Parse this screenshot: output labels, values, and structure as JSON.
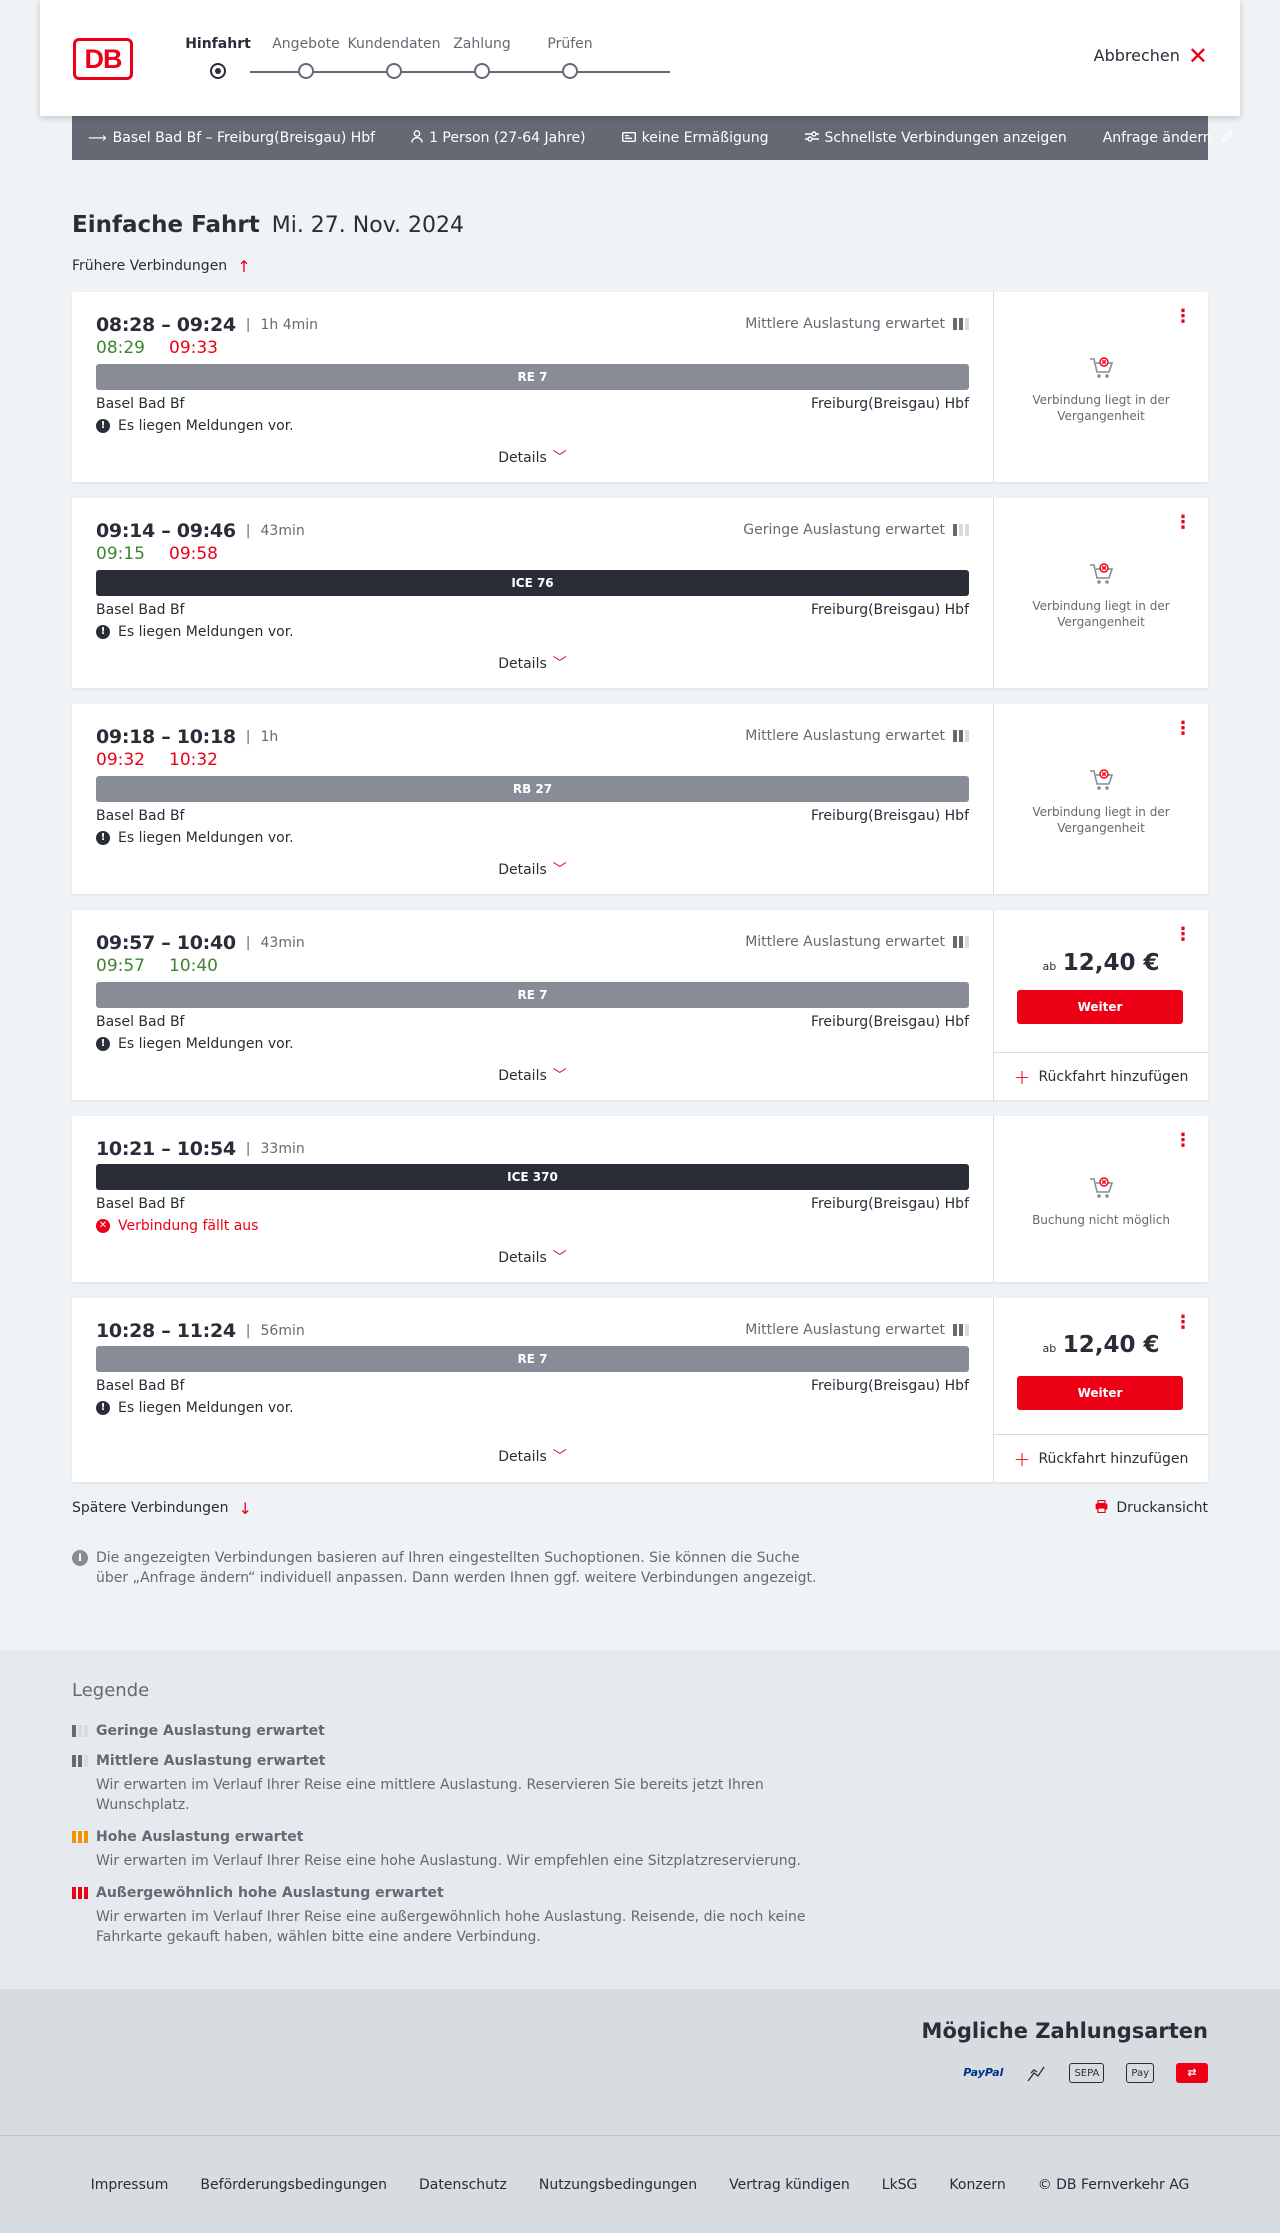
{
  "header": {
    "logo": "DB",
    "steps": [
      {
        "label": "Hinfahrt",
        "active": true
      },
      {
        "label": "Angebote",
        "active": false
      },
      {
        "label": "Kundendaten",
        "active": false
      },
      {
        "label": "Zahlung",
        "active": false
      },
      {
        "label": "Prüfen",
        "active": false
      }
    ],
    "cancel_label": "Abbrechen"
  },
  "search": {
    "route": "Basel Bad Bf – Freiburg(Breisgau) Hbf",
    "passengers": "1 Person (27-64 Jahre)",
    "discount": "keine Ermäßigung",
    "fastest": "Schnellste Verbindungen anzeigen",
    "edit_label": "Anfrage ändern"
  },
  "page": {
    "title": "Einfache Fahrt",
    "date": "Mi. 27. Nov. 2024",
    "earlier_label": "Frühere Verbindungen",
    "later_label": "Spätere Verbindungen",
    "print_label": "Druckansicht",
    "info_note": "Die angezeigten Verbindungen basieren auf Ihren eingestellten Suchoptionen. Sie können die Suche über „Anfrage ändern“ individuell anpassen. Dann werden Ihnen ggf. weitere Verbindungen angezeigt."
  },
  "connections": [
    {
      "times": "08:28 – 09:24",
      "duration": "1h 4min",
      "rt_dep": "08:29",
      "rt_dep_status": "green",
      "rt_arr": "09:33",
      "rt_arr_status": "red",
      "load": "Mittlere Auslastung erwartet",
      "train": "RE 7",
      "train_style": "grey",
      "from": "Basel Bad Bf",
      "to": "Freiburg(Breisgau) Hbf",
      "notice": "Es liegen Meldungen vor.",
      "details": "Details",
      "status": "Verbindung liegt in der Vergangenheit"
    },
    {
      "times": "09:14 – 09:46",
      "duration": "43min",
      "rt_dep": "09:15",
      "rt_dep_status": "green",
      "rt_arr": "09:58",
      "rt_arr_status": "red",
      "load": "Geringe Auslastung erwartet",
      "train": "ICE 76",
      "train_style": "dark",
      "from": "Basel Bad Bf",
      "to": "Freiburg(Breisgau) Hbf",
      "notice": "Es liegen Meldungen vor.",
      "details": "Details",
      "status": "Verbindung liegt in der Vergangenheit"
    },
    {
      "times": "09:18 – 10:18",
      "duration": "1h",
      "rt_dep": "09:32",
      "rt_dep_status": "red",
      "rt_arr": "10:32",
      "rt_arr_status": "red",
      "load": "Mittlere Auslastung erwartet",
      "train": "RB 27",
      "train_style": "grey",
      "from": "Basel Bad Bf",
      "to": "Freiburg(Breisgau) Hbf",
      "notice": "Es liegen Meldungen vor.",
      "details": "Details",
      "status": "Verbindung liegt in der Vergangenheit"
    },
    {
      "times": "09:57 – 10:40",
      "duration": "43min",
      "rt_dep": "09:57",
      "rt_dep_status": "green",
      "rt_arr": "10:40",
      "rt_arr_status": "green",
      "load": "Mittlere Auslastung erwartet",
      "train": "RE 7",
      "train_style": "grey",
      "from": "Basel Bad Bf",
      "to": "Freiburg(Breisgau) Hbf",
      "notice": "Es liegen Meldungen vor.",
      "details": "Details",
      "price_prefix": "ab",
      "price": "12,40 €",
      "button": "Weiter",
      "return_add": "Rückfahrt hinzufügen"
    },
    {
      "times": "10:21 – 10:54",
      "duration": "33min",
      "train": "ICE 370",
      "train_style": "dark",
      "from": "Basel Bad Bf",
      "to": "Freiburg(Breisgau) Hbf",
      "notice": "Verbindung fällt aus",
      "details": "Details",
      "status": "Buchung nicht möglich"
    },
    {
      "times": "10:28 – 11:24",
      "duration": "56min",
      "load": "Mittlere Auslastung erwartet",
      "train": "RE 7",
      "train_style": "grey",
      "from": "Basel Bad Bf",
      "to": "Freiburg(Breisgau) Hbf",
      "notice": "Es liegen Meldungen vor.",
      "details": "Details",
      "price_prefix": "ab",
      "price": "12,40 €",
      "button": "Weiter",
      "return_add": "Rückfahrt hinzufügen"
    }
  ],
  "legend": {
    "title": "Legende",
    "items": [
      {
        "label": "Geringe Auslastung erwartet",
        "text": ""
      },
      {
        "label": "Mittlere Auslastung erwartet",
        "text": "Wir erwarten im Verlauf Ihrer Reise eine mittlere Auslastung. Reservieren Sie bereits jetzt Ihren Wunschplatz."
      },
      {
        "label": "Hohe Auslastung erwartet",
        "text": "Wir erwarten im Verlauf Ihrer Reise eine hohe Auslastung. Wir empfehlen eine Sitzplatzreservierung."
      },
      {
        "label": "Außergewöhnlich hohe Auslastung erwartet",
        "text": "Wir erwarten im Verlauf Ihrer Reise eine außergewöhnlich hohe Auslastung. Reisende, die noch keine Fahrkarte gekauft haben, wählen bitte eine andere Verbindung."
      }
    ]
  },
  "payment": {
    "title": "Mögliche Zahlungsarten",
    "methods": [
      "PayPal",
      "Kreditkarte",
      "SEPA",
      "Apple Pay",
      "DB"
    ]
  },
  "footer": {
    "links": [
      "Impressum",
      "Beförderungsbedingungen",
      "Datenschutz",
      "Nutzungsbedingungen",
      "Vertrag kündigen",
      "LkSG",
      "Konzern"
    ],
    "copyright": "© DB Fernverkehr AG"
  },
  "colors": {
    "db_red": "#ec0016",
    "ontime_green": "#408335",
    "text_dark": "#282d37",
    "text_grey": "#646973"
  }
}
